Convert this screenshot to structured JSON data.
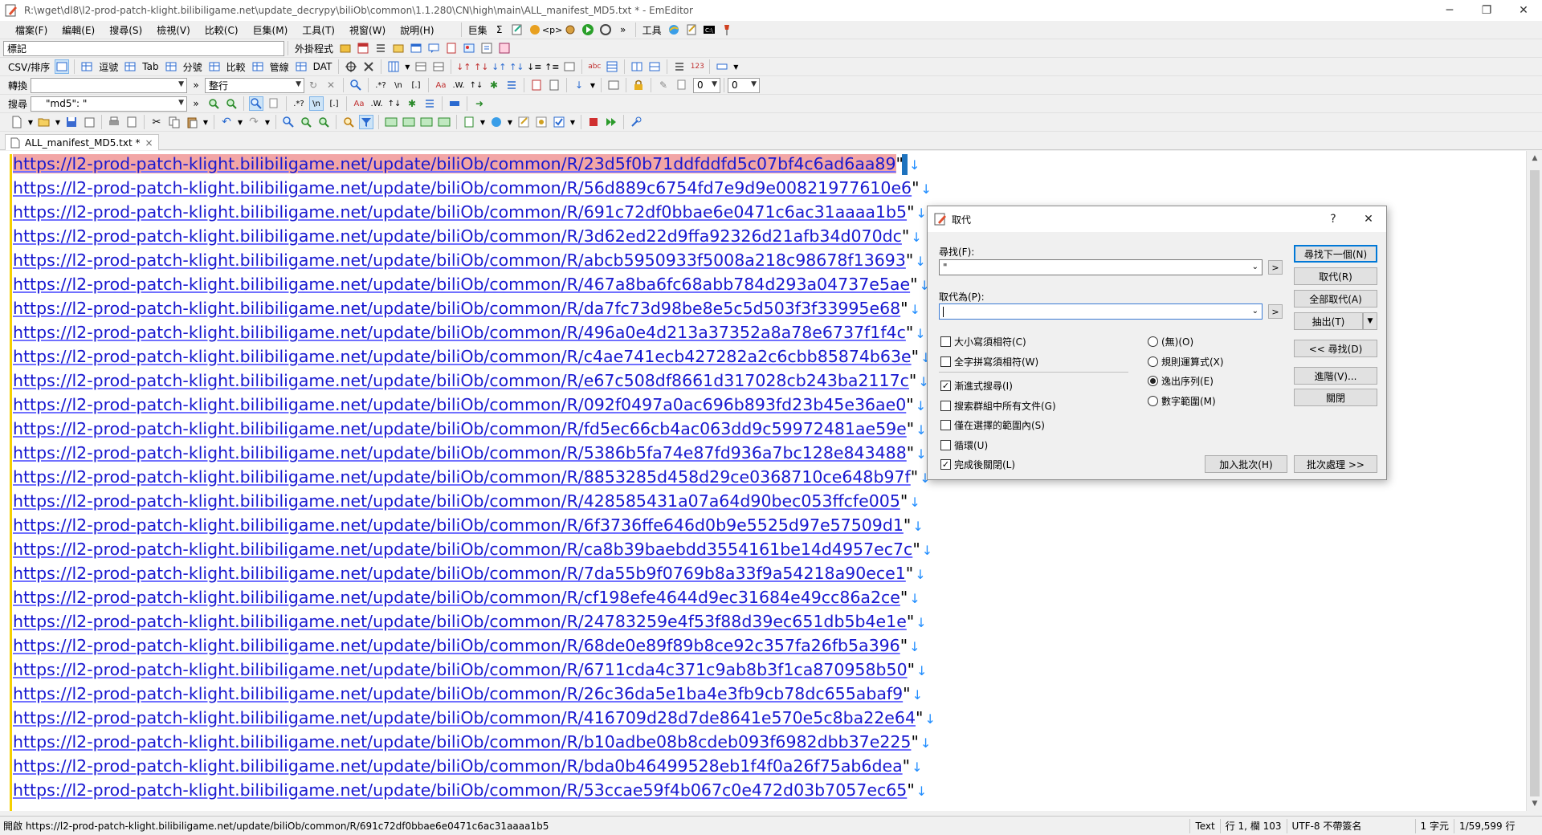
{
  "window": {
    "title": "R:\\wget\\dl8\\l2-prod-patch-klight.bilibiligame.net\\update_decrypy\\biliOb\\common\\1.1.280\\CN\\high\\main\\ALL_manifest_MD5.txt * - EmEditor"
  },
  "menu": {
    "items": [
      "檔案(F)",
      "編輯(E)",
      "搜尋(S)",
      "檢視(V)",
      "比較(C)",
      "巨集(M)",
      "工具(T)",
      "視窗(W)",
      "說明(H)"
    ],
    "macro_label": "巨集",
    "tools_label": "工具"
  },
  "toolbars": {
    "marker_label": "標記",
    "external_label": "外掛程式",
    "csv_label": "CSV/排序",
    "csv_buttons": [
      "逗號",
      "Tab",
      "分號",
      "比較",
      "管線",
      "DAT"
    ],
    "convert_label": "轉換",
    "convert_value": "",
    "line_label": "整行",
    "search_label": "搜尋",
    "search_value": "\"md5\": \"",
    "zero_a": "0",
    "zero_b": "0"
  },
  "tab": {
    "label": "ALL_manifest_MD5.txt *",
    "close": "×"
  },
  "editor": {
    "prefix": "https://l2-prod-patch-klight.bilibiligame.net/update/biliOb/common/R/",
    "newline_mark": "↓",
    "quote": "\"",
    "lines": [
      "23d5f0b71ddfddfd5c07bf4c6ad6aa89",
      "56d889c6754fd7e9d9e00821977610e6",
      "691c72df0bbae6e0471c6ac31aaaa1b5",
      "3d62ed22d9ffa92326d21afb34d070dc",
      "abcb5950933f5008a218c98678f13693",
      "467a8ba6fc68abb784d293a04737e5ae",
      "da7fc73d98be8e5c5d503f3f33995e68",
      "496a0e4d213a37352a8a78e6737f1f4c",
      "c4ae741ecb427282a2c6cbb85874b63e",
      "e67c508df8661d317028cb243ba2117c",
      "092f0497a0ac696b893fd23b45e36ae0",
      "fd5ec66cb4ac063dd9c59972481ae59e",
      "5386b5fa74e87fd936a7bc128e843488",
      "8853285d458d29ce0368710ce648b97f",
      "428585431a07a64d90bec053ffcfe005",
      "6f3736ffe646d0b9e5525d97e57509d1",
      "ca8b39baebdd3554161be14d4957ec7c",
      "7da55b9f0769b8a33f9a54218a90ece1",
      "cf198efe4644d9ec31684e49cc86a2ce",
      "24783259e4f53f88d39ec651db5b4e1e",
      "68de0e89f89b8ce92c357fa26fb5a396",
      "6711cda4c371c9ab8b3f1ca870958b50",
      "26c36da5e1ba4e3fb9cb78dc655abaf9",
      "416709d28d7de8641e570e5c8ba22e64",
      "b10adbe08b8cdeb093f6982dbb37e225",
      "bda0b46499528eb1f4f0a26f75ab6dea",
      "53ccae59f4b067c0e472d03b7057ec65"
    ],
    "quoted_flags": [
      false,
      true,
      true,
      true,
      true,
      true,
      false,
      false,
      true,
      true,
      true,
      true,
      true,
      true,
      false,
      false,
      true,
      true,
      false,
      true,
      false,
      true,
      false,
      true,
      true,
      true,
      false
    ]
  },
  "status": {
    "open_text": "開啟 https://l2-prod-patch-klight.bilibiligame.net/update/biliOb/common/R/691c72df0bbae6e0471c6ac31aaaa1b5",
    "mode": "Text",
    "position": "行 1, 欄 103",
    "encoding": "UTF-8 不帶簽名",
    "chars": "1 字元",
    "lines": "1/59,599 行"
  },
  "dialog": {
    "title": "取代",
    "help": "?",
    "close": "✕",
    "find_label": "尋找(F):",
    "find_value": "\"",
    "replace_label": "取代為(P):",
    "replace_value": "",
    "arrow_btn": ">",
    "buttons": {
      "find_next": "尋找下一個(N)",
      "replace": "取代(R)",
      "replace_all": "全部取代(A)",
      "extract": "抽出(T)",
      "find_back": "<< 尋找(D)",
      "advanced": "進階(V)...",
      "close": "關閉",
      "add_batch": "加入批次(H)",
      "batch": "批次處理 >>"
    },
    "checks": [
      {
        "label": "大小寫須相符(C)",
        "checked": false
      },
      {
        "label": "全字拼寫須相符(W)",
        "checked": false
      },
      {
        "label": "漸進式搜尋(I)",
        "checked": true
      },
      {
        "label": "搜索群組中所有文件(G)",
        "checked": false
      },
      {
        "label": "僅在選擇的範圍內(S)",
        "checked": false
      },
      {
        "label": "循環(U)",
        "checked": false
      },
      {
        "label": "完成後關閉(L)",
        "checked": true
      }
    ],
    "radios": [
      {
        "label": "(無)(O)",
        "checked": false
      },
      {
        "label": "規則運算式(X)",
        "checked": false
      },
      {
        "label": "逸出序列(E)",
        "checked": true
      },
      {
        "label": "數字範圍(M)",
        "checked": false
      }
    ]
  },
  "colors": {
    "link": "#1818d0",
    "selection": "#f2a6a6",
    "gutter": "#f5d000",
    "accent": "#0078d7"
  }
}
